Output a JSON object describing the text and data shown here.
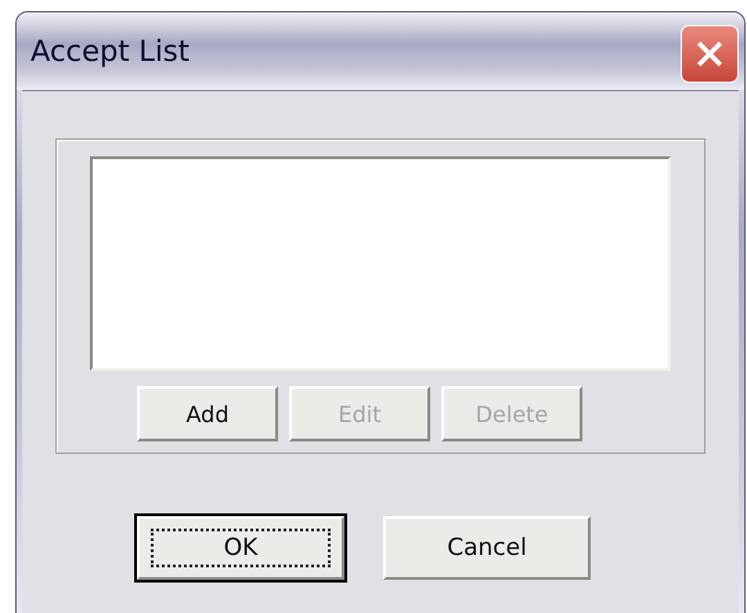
{
  "window": {
    "title": "Accept List"
  },
  "list_buttons": [
    {
      "label": "Add",
      "disabled": false
    },
    {
      "label": "Edit",
      "disabled": true
    },
    {
      "label": "Delete",
      "disabled": true
    }
  ],
  "dialog_buttons": [
    {
      "label": "OK",
      "default": true
    },
    {
      "label": "Cancel",
      "default": false
    }
  ]
}
